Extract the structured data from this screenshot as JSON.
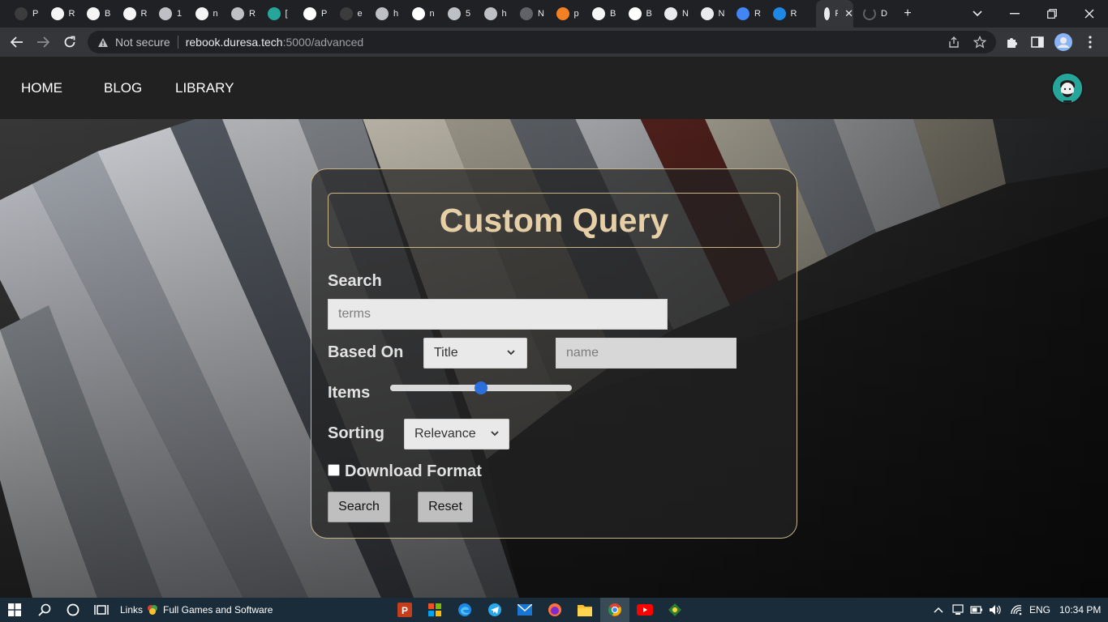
{
  "browser": {
    "tabs": [
      {
        "label": "P",
        "icon": "dark-circle-icon"
      },
      {
        "label": "R",
        "icon": "github-icon"
      },
      {
        "label": "B",
        "icon": "github-icon"
      },
      {
        "label": "R",
        "icon": "github-icon"
      },
      {
        "label": "1",
        "icon": "globe-icon"
      },
      {
        "label": "n",
        "icon": "github-icon"
      },
      {
        "label": "R",
        "icon": "globe-icon"
      },
      {
        "label": "[",
        "icon": "gear-green-icon"
      },
      {
        "label": "P",
        "icon": "triangle-icon"
      },
      {
        "label": "e",
        "icon": "dark-circle-icon"
      },
      {
        "label": "h",
        "icon": "globe-icon"
      },
      {
        "label": "n",
        "icon": "triangle-icon"
      },
      {
        "label": "5",
        "icon": "globe-icon"
      },
      {
        "label": "h",
        "icon": "globe-icon"
      },
      {
        "label": "N",
        "icon": "m4-icon"
      },
      {
        "label": "p",
        "icon": "stack-icon"
      },
      {
        "label": "B",
        "icon": "github-icon"
      },
      {
        "label": "B",
        "icon": "n-icon"
      },
      {
        "label": "N",
        "icon": "chrome-icon"
      },
      {
        "label": "N",
        "icon": "chrome-icon"
      },
      {
        "label": "R",
        "icon": "docs-icon"
      },
      {
        "label": "R",
        "icon": "trello-icon"
      },
      {
        "label": "Re",
        "icon": "page-icon",
        "active": true
      },
      {
        "label": "D",
        "icon": "loading-icon"
      }
    ],
    "address": {
      "security_label": "Not secure",
      "host": "rebook.duresa.tech",
      "path": ":5000/advanced"
    }
  },
  "nav": {
    "links": [
      "HOME",
      "BLOG",
      "LIBRARY"
    ]
  },
  "form": {
    "title": "Custom Query",
    "search_label": "Search",
    "search_placeholder": "terms",
    "based_on_label": "Based On",
    "based_on_value": "Title",
    "name_placeholder": "name",
    "items_label": "Items",
    "items_slider_fraction": 0.5,
    "sorting_label": "Sorting",
    "sorting_value": "Relevance",
    "download_label": "Download Format",
    "download_checked": false,
    "search_button": "Search",
    "reset_button": "Reset"
  },
  "taskbar": {
    "links_label": "Links",
    "folder_label": "Full Games and Software",
    "language": "ENG",
    "time": "10:34 PM"
  }
}
